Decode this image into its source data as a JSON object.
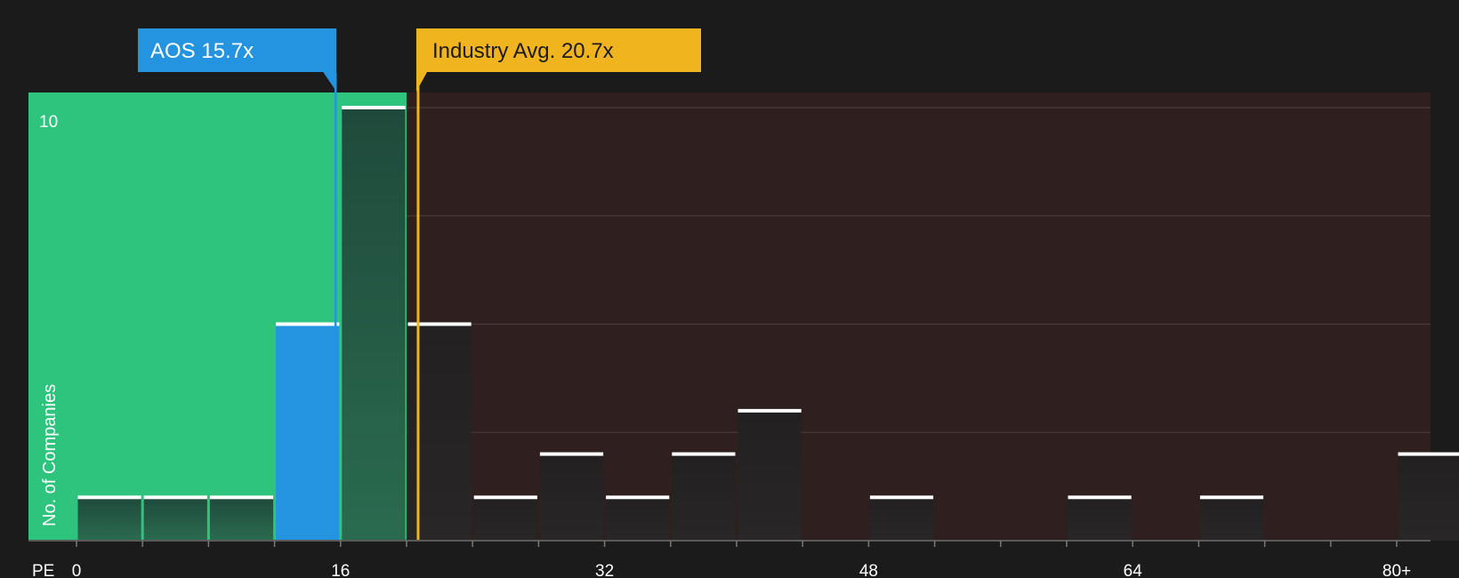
{
  "chart_data": {
    "type": "bar",
    "xlabel": "PE",
    "ylabel": "No. of Companies",
    "x_ticks": [
      "0",
      "16",
      "32",
      "48",
      "64",
      "80+"
    ],
    "y_ticks": [
      "10"
    ],
    "xlim": [
      0,
      80
    ],
    "ylim": [
      0,
      10.4
    ],
    "bin_width": 4,
    "bins": [
      {
        "x0": 0,
        "count": 1
      },
      {
        "x0": 4,
        "count": 1
      },
      {
        "x0": 8,
        "count": 1
      },
      {
        "x0": 12,
        "count": 5
      },
      {
        "x0": 16,
        "count": 10
      },
      {
        "x0": 20,
        "count": 5
      },
      {
        "x0": 24,
        "count": 1
      },
      {
        "x0": 28,
        "count": 2
      },
      {
        "x0": 32,
        "count": 1
      },
      {
        "x0": 36,
        "count": 2
      },
      {
        "x0": 40,
        "count": 3
      },
      {
        "x0": 48,
        "count": 1
      },
      {
        "x0": 60,
        "count": 1
      },
      {
        "x0": 68,
        "count": 1
      },
      {
        "x0": 80,
        "count": 2
      }
    ],
    "subject": {
      "label": "AOS 15.7x",
      "value": 15.7
    },
    "industry_avg": {
      "label": "Industry Avg. 20.7x",
      "value": 20.7
    },
    "colors": {
      "background": "#1b1b1b",
      "undervalued_region": "#2ec47e",
      "overvalued_region": "#2f1f1f",
      "subject": "#2494e0",
      "industry": "#f0b41e",
      "bar": "#262424",
      "bar_in_green": "#1e4a3a",
      "bar_top": "#ffffff"
    }
  }
}
